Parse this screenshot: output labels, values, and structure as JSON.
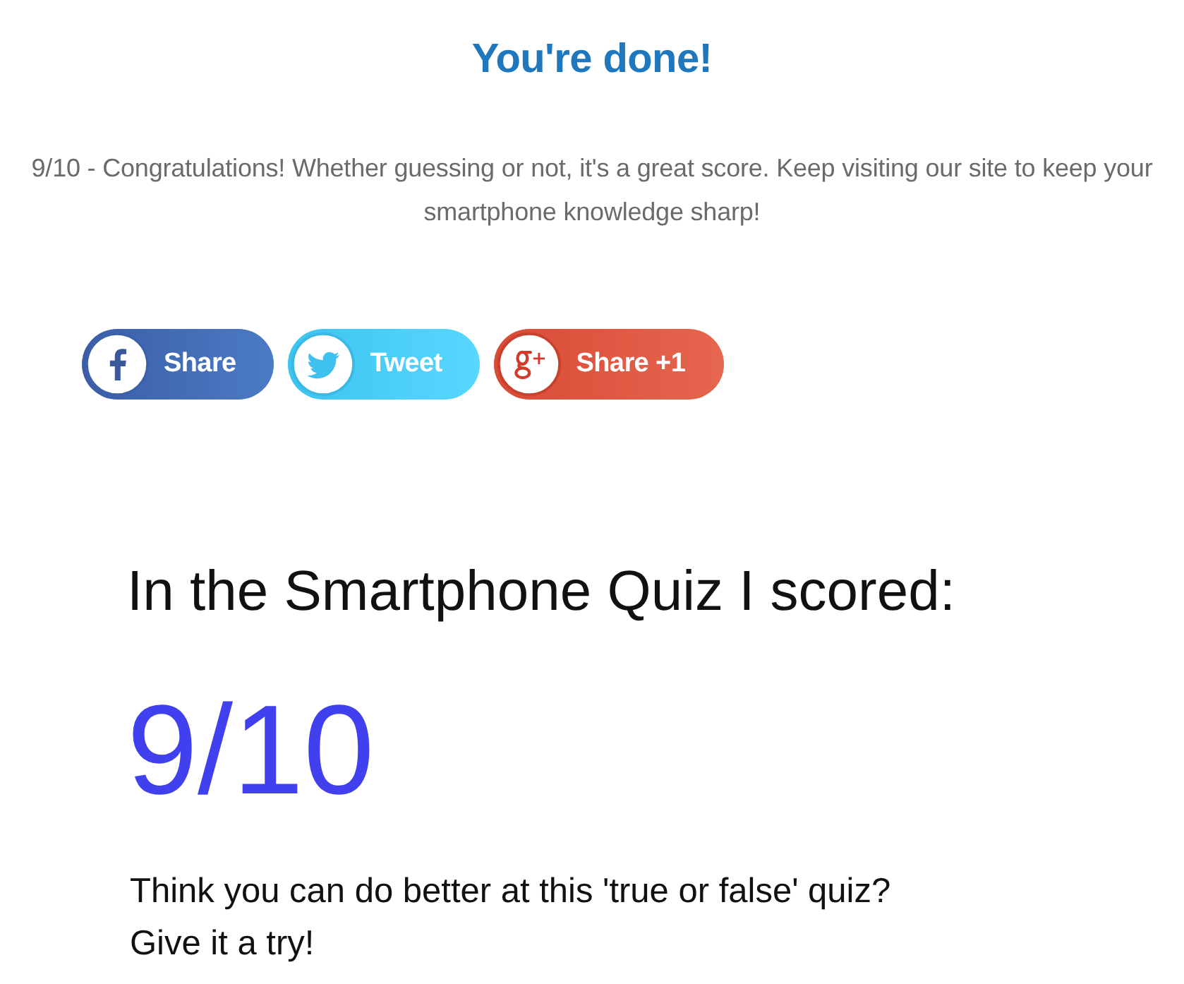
{
  "title": "You're done!",
  "message": "9/10 - Congratulations! Whether guessing or not, it's a great score. Keep visiting our site to keep your smartphone knowledge sharp!",
  "share_buttons": [
    {
      "kind": "facebook",
      "label": "Share"
    },
    {
      "kind": "twitter",
      "label": "Tweet"
    },
    {
      "kind": "google_plus",
      "label": "Share +1"
    }
  ],
  "result_card": {
    "heading": "In the Smartphone Quiz I scored:",
    "score": "9/10",
    "invitation": "Think you can do better at this 'true or false' quiz?",
    "call_to_action": "Give it a try!"
  }
}
